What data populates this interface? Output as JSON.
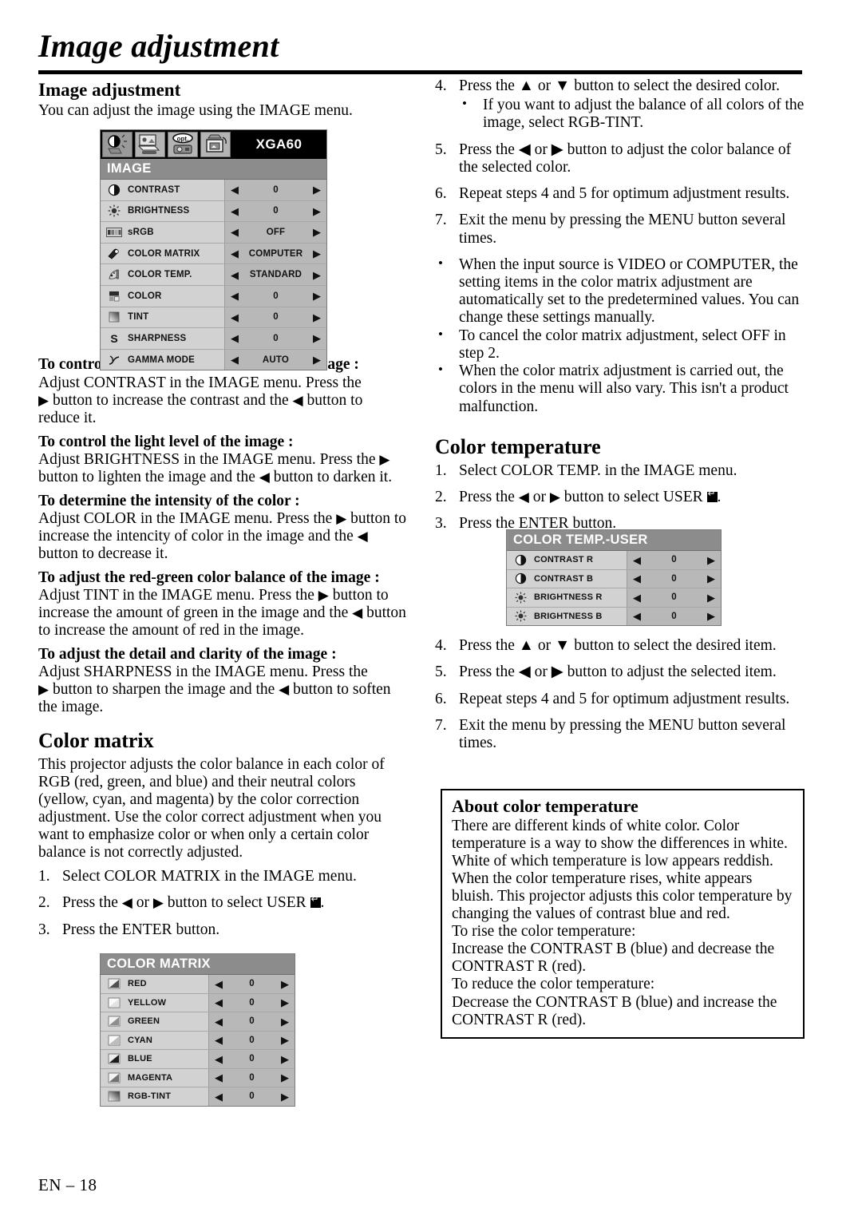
{
  "page": {
    "title": "Image adjustment",
    "footer": "EN – 18"
  },
  "left_column": {
    "section_heading": "Image adjustment",
    "intro": "You can adjust the image using the IMAGE menu.",
    "subsections": [
      {
        "heading": "To control the white-to-black level of the image :",
        "body_1": "Adjust CONTRAST in the IMAGE menu.  Press the",
        "body_2": " button to increase the contrast and the ",
        "body_3": " button to reduce it."
      },
      {
        "heading": "To control the light level of the image :",
        "body_1": "Adjust BRIGHTNESS in the IMAGE menu.  Press the",
        "body_2": " button to lighten the image and the ",
        "body_3": " button to darken it."
      },
      {
        "heading": "To determine the intensity of the color :",
        "body_1": "Adjust COLOR in the IMAGE menu.  Press the",
        "body_2": " button to increase the intencity of color in the image and the ",
        "body_3": " button to decrease it."
      },
      {
        "heading": "To adjust the red-green color balance of the image :",
        "body_1": "Adjust TINT in the IMAGE menu.  Press the",
        "body_2": " button to increase the amount of green in the image and the ",
        "body_3": " button to increase the amount of red in the image."
      },
      {
        "heading": "To adjust the detail and clarity of the image :",
        "body_1": "Adjust SHARPNESS in the IMAGE menu.  Press the",
        "body_2": " button to sharpen the image and the ",
        "body_3": " button to soften the image."
      }
    ],
    "color_matrix": {
      "heading": "Color matrix",
      "paragraph": "This projector adjusts the color balance in each color of RGB (red, green, and blue) and their neutral colors (yellow, cyan, and magenta) by the color correction adjustment. Use the color correct adjustment when you want to emphasize color or when only a certain color balance is not correctly adjusted.",
      "steps": [
        {
          "num": "1.",
          "pre": "Select COLOR MATRIX in the IMAGE menu.",
          "post": ""
        },
        {
          "num": "2.",
          "pre": "Press the ",
          "mid": " or ",
          "post": " button to select USER "
        },
        {
          "num": "3.",
          "pre": "Press the ENTER button.",
          "post": ""
        }
      ]
    }
  },
  "right_column": {
    "steps_matrix": [
      {
        "num": "4.",
        "text": "Press the ▲ or ▼ button to select the desired color.",
        "sub": "If you want to adjust the balance of all colors of the image, select RGB-TINT."
      },
      {
        "num": "5.",
        "text": "Press the ◀ or ▶ button to adjust the color balance of the selected color."
      },
      {
        "num": "6.",
        "text": "Repeat steps 4 and 5 for optimum adjustment results."
      },
      {
        "num": "7.",
        "text": "Exit the menu by pressing the MENU button several times."
      }
    ],
    "notes_matrix": [
      "When the input source is VIDEO or COMPUTER, the setting items in the color matrix adjustment are automatically set to the predetermined values. You can change these settings manually.",
      "To cancel the color matrix adjustment, select OFF in step 2.",
      "When the color matrix adjustment is carried out, the colors in the menu will also vary. This isn't a product malfunction."
    ],
    "color_temperature": {
      "heading": "Color temperature",
      "steps_pre": [
        {
          "num": "1.",
          "text": "Select COLOR TEMP. in the IMAGE menu."
        },
        {
          "num": "2.",
          "pre": "Press the ",
          "mid": " or ",
          "post": " button to select USER "
        },
        {
          "num": "3.",
          "text": "Press the ENTER button."
        }
      ],
      "steps_post": [
        {
          "num": "4.",
          "text": "Press the ▲ or ▼ button to select the desired item."
        },
        {
          "num": "5.",
          "text": "Press the ◀ or ▶ button to adjust the selected item."
        },
        {
          "num": "6.",
          "text": "Repeat steps 4 and 5 for optimum adjustment results."
        },
        {
          "num": "7.",
          "text": "Exit the menu by pressing the MENU button several times."
        }
      ]
    },
    "about_box": {
      "heading": "About color temperature",
      "paragraph": "There are different kinds of white color. Color temperature is a way to show the differences in white. White of which temperature is low appears reddish. When the color temperature rises, white appears bluish. This projector adjusts this color temperature by changing the values of contrast blue and red.\nTo rise the color temperature:\nIncrease the CONTRAST B (blue) and decrease the CONTRAST R (red).\nTo reduce the color temperature:\nDecrease the CONTRAST B (blue) and increase the CONTRAST R (red)."
    }
  },
  "osd_menus": {
    "image": {
      "signal_label": "XGA60",
      "header": "IMAGE",
      "tabs": [
        "image-tab-icon",
        "install-tab-icon",
        "option-tab-icon",
        "feature-tab-icon"
      ],
      "rows": [
        {
          "icon": "contrast-icon",
          "label": "CONTRAST",
          "value": "0"
        },
        {
          "icon": "brightness-icon",
          "label": "BRIGHTNESS",
          "value": "0"
        },
        {
          "icon": "srgb-icon",
          "label": "sRGB",
          "value": "OFF"
        },
        {
          "icon": "color-matrix-icon",
          "label": "COLOR MATRIX",
          "value": "COMPUTER"
        },
        {
          "icon": "color-temp-icon",
          "label": "COLOR TEMP.",
          "value": "STANDARD"
        },
        {
          "icon": "color-icon",
          "label": "COLOR",
          "value": "0"
        },
        {
          "icon": "tint-icon",
          "label": "TINT",
          "value": "0"
        },
        {
          "icon": "sharpness-icon",
          "label": "SHARPNESS",
          "value": "0"
        },
        {
          "icon": "gamma-icon",
          "label": "GAMMA MODE",
          "value": "AUTO"
        }
      ]
    },
    "color_matrix": {
      "header": "COLOR MATRIX",
      "rows": [
        {
          "icon": "red-swatch-icon",
          "label": "RED",
          "value": "0"
        },
        {
          "icon": "yellow-swatch-icon",
          "label": "YELLOW",
          "value": "0"
        },
        {
          "icon": "green-swatch-icon",
          "label": "GREEN",
          "value": "0"
        },
        {
          "icon": "cyan-swatch-icon",
          "label": "CYAN",
          "value": "0"
        },
        {
          "icon": "blue-swatch-icon",
          "label": "BLUE",
          "value": "0"
        },
        {
          "icon": "magenta-swatch-icon",
          "label": "MAGENTA",
          "value": "0"
        },
        {
          "icon": "rgb-tint-swatch-icon",
          "label": "RGB-TINT",
          "value": "0"
        }
      ]
    },
    "color_temp_user": {
      "header": "COLOR TEMP.-USER",
      "rows": [
        {
          "icon": "contrast-icon",
          "label": "CONTRAST R",
          "value": "0"
        },
        {
          "icon": "contrast-icon",
          "label": "CONTRAST B",
          "value": "0"
        },
        {
          "icon": "brightness-icon",
          "label": "BRIGHTNESS R",
          "value": "0"
        },
        {
          "icon": "brightness-icon",
          "label": "BRIGHTNESS B",
          "value": "0"
        }
      ]
    }
  },
  "glyphs": {
    "left_arrow": "◀",
    "right_arrow": "▶",
    "up_arrow": "▲",
    "down_arrow": "▼"
  }
}
